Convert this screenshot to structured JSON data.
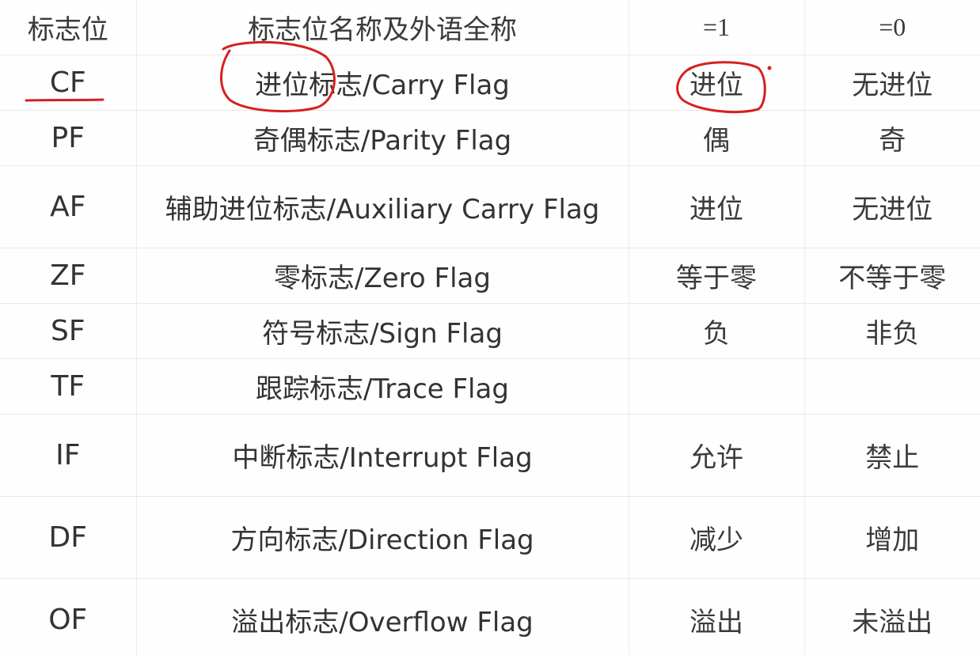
{
  "table": {
    "headers": [
      "标志位",
      "标志位名称及外语全称",
      "=1",
      "=0"
    ],
    "rows": [
      {
        "abbr": "CF",
        "name": "进位标志/Carry Flag",
        "one": "进位",
        "zero": "无进位"
      },
      {
        "abbr": "PF",
        "name": "奇偶标志/Parity Flag",
        "one": "偶",
        "zero": "奇"
      },
      {
        "abbr": "AF",
        "name": "辅助进位标志/Auxiliary Carry Flag",
        "one": "进位",
        "zero": "无进位"
      },
      {
        "abbr": "ZF",
        "name": "零标志/Zero Flag",
        "one": "等于零",
        "zero": "不等于零"
      },
      {
        "abbr": "SF",
        "name": "符号标志/Sign Flag",
        "one": "负",
        "zero": "非负"
      },
      {
        "abbr": "TF",
        "name": "跟踪标志/Trace Flag",
        "one": "",
        "zero": ""
      },
      {
        "abbr": "IF",
        "name": "中断标志/Interrupt Flag",
        "one": "允许",
        "zero": "禁止"
      },
      {
        "abbr": "DF",
        "name": "方向标志/Direction Flag",
        "one": "减少",
        "zero": "增加"
      },
      {
        "abbr": "OF",
        "name": "溢出标志/Overflow Flag",
        "one": "溢出",
        "zero": "未溢出"
      }
    ]
  },
  "annotations": {
    "ink_color": "#d62020",
    "marks": [
      "underline-cf",
      "circle-carry-flag-name",
      "circle-carry-value"
    ]
  }
}
